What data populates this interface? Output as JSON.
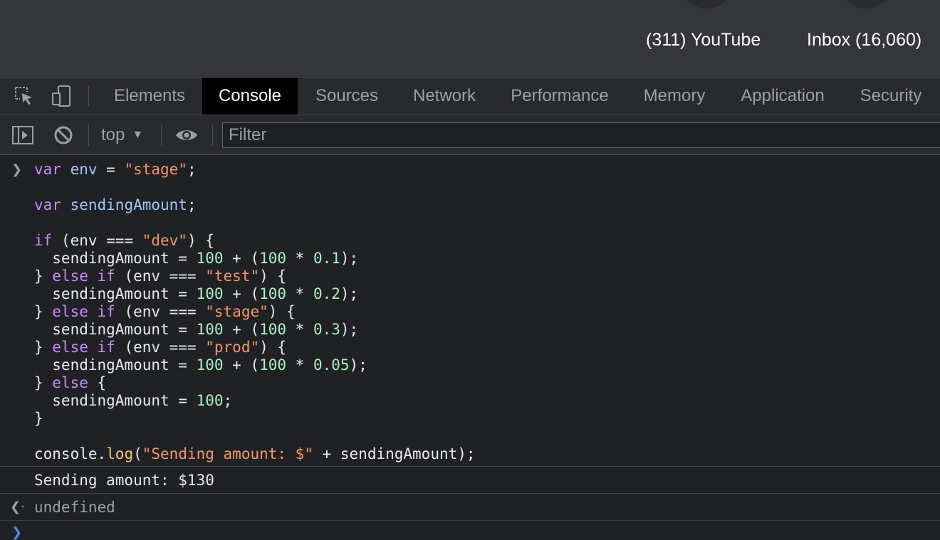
{
  "shortcuts": [
    {
      "label": "(311) YouTube"
    },
    {
      "label": "Inbox (16,060)"
    }
  ],
  "devtools": {
    "tabs": [
      {
        "label": "Elements",
        "active": false
      },
      {
        "label": "Console",
        "active": true
      },
      {
        "label": "Sources",
        "active": false
      },
      {
        "label": "Network",
        "active": false
      },
      {
        "label": "Performance",
        "active": false
      },
      {
        "label": "Memory",
        "active": false
      },
      {
        "label": "Application",
        "active": false
      },
      {
        "label": "Security",
        "active": false
      }
    ],
    "icons": {
      "inspect": "inspect-element-icon",
      "device": "device-toolbar-icon"
    }
  },
  "console_toolbar": {
    "context": "top",
    "filter_placeholder": "Filter",
    "icons": {
      "sidebar": "show-sidebar-icon",
      "clear": "clear-console-icon",
      "caret": "caret-down-icon",
      "live_expression": "eye-icon"
    }
  },
  "console": {
    "input_lines": [
      [
        {
          "t": "var",
          "c": "kw"
        },
        {
          "t": " ",
          "c": "prop"
        },
        {
          "t": "env",
          "c": "var"
        },
        {
          "t": " = ",
          "c": "prop"
        },
        {
          "t": "\"stage\"",
          "c": "str"
        },
        {
          "t": ";",
          "c": "prop"
        }
      ],
      [],
      [
        {
          "t": "var",
          "c": "kw"
        },
        {
          "t": " ",
          "c": "prop"
        },
        {
          "t": "sendingAmount",
          "c": "var"
        },
        {
          "t": ";",
          "c": "prop"
        }
      ],
      [],
      [
        {
          "t": "if",
          "c": "kw"
        },
        {
          "t": " (env === ",
          "c": "prop"
        },
        {
          "t": "\"dev\"",
          "c": "str"
        },
        {
          "t": ") {",
          "c": "prop"
        }
      ],
      [
        {
          "t": "  sendingAmount = ",
          "c": "prop"
        },
        {
          "t": "100",
          "c": "num"
        },
        {
          "t": " + (",
          "c": "prop"
        },
        {
          "t": "100",
          "c": "num"
        },
        {
          "t": " * ",
          "c": "prop"
        },
        {
          "t": "0.1",
          "c": "num"
        },
        {
          "t": ");",
          "c": "prop"
        }
      ],
      [
        {
          "t": "} ",
          "c": "prop"
        },
        {
          "t": "else if",
          "c": "kw"
        },
        {
          "t": " (env === ",
          "c": "prop"
        },
        {
          "t": "\"test\"",
          "c": "str"
        },
        {
          "t": ") {",
          "c": "prop"
        }
      ],
      [
        {
          "t": "  sendingAmount = ",
          "c": "prop"
        },
        {
          "t": "100",
          "c": "num"
        },
        {
          "t": " + (",
          "c": "prop"
        },
        {
          "t": "100",
          "c": "num"
        },
        {
          "t": " * ",
          "c": "prop"
        },
        {
          "t": "0.2",
          "c": "num"
        },
        {
          "t": ");",
          "c": "prop"
        }
      ],
      [
        {
          "t": "} ",
          "c": "prop"
        },
        {
          "t": "else if",
          "c": "kw"
        },
        {
          "t": " (env === ",
          "c": "prop"
        },
        {
          "t": "\"stage\"",
          "c": "str"
        },
        {
          "t": ") {",
          "c": "prop"
        }
      ],
      [
        {
          "t": "  sendingAmount = ",
          "c": "prop"
        },
        {
          "t": "100",
          "c": "num"
        },
        {
          "t": " + (",
          "c": "prop"
        },
        {
          "t": "100",
          "c": "num"
        },
        {
          "t": " * ",
          "c": "prop"
        },
        {
          "t": "0.3",
          "c": "num"
        },
        {
          "t": ");",
          "c": "prop"
        }
      ],
      [
        {
          "t": "} ",
          "c": "prop"
        },
        {
          "t": "else if",
          "c": "kw"
        },
        {
          "t": " (env === ",
          "c": "prop"
        },
        {
          "t": "\"prod\"",
          "c": "str"
        },
        {
          "t": ") {",
          "c": "prop"
        }
      ],
      [
        {
          "t": "  sendingAmount = ",
          "c": "prop"
        },
        {
          "t": "100",
          "c": "num"
        },
        {
          "t": " + (",
          "c": "prop"
        },
        {
          "t": "100",
          "c": "num"
        },
        {
          "t": " * ",
          "c": "prop"
        },
        {
          "t": "0.05",
          "c": "num"
        },
        {
          "t": ");",
          "c": "prop"
        }
      ],
      [
        {
          "t": "} ",
          "c": "prop"
        },
        {
          "t": "else",
          "c": "kw"
        },
        {
          "t": " {",
          "c": "prop"
        }
      ],
      [
        {
          "t": "  sendingAmount = ",
          "c": "prop"
        },
        {
          "t": "100",
          "c": "num"
        },
        {
          "t": ";",
          "c": "prop"
        }
      ],
      [
        {
          "t": "}",
          "c": "prop"
        }
      ],
      [],
      [
        {
          "t": "console.",
          "c": "prop"
        },
        {
          "t": "log",
          "c": "fn"
        },
        {
          "t": "(",
          "c": "prop"
        },
        {
          "t": "\"Sending amount: $\"",
          "c": "str"
        },
        {
          "t": " + sendingAmount);",
          "c": "prop"
        }
      ]
    ],
    "log_output": "Sending amount: $130",
    "result": "undefined"
  },
  "colors": {
    "keyword": "#c58af9",
    "variable": "#9cc7f7",
    "string": "#f29766",
    "number": "#a8f0c1",
    "function": "#f0c674",
    "text": "#e8eaed",
    "muted": "#9aa0a6"
  }
}
